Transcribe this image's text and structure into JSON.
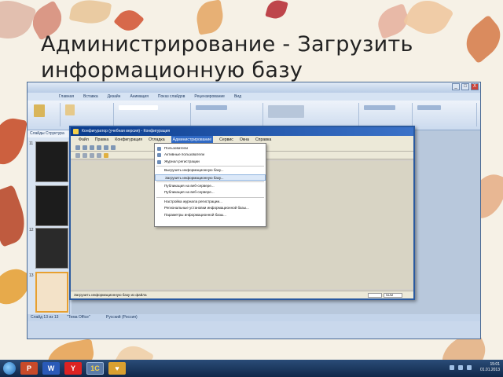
{
  "slide": {
    "title": "Администрирование - Загрузить информационную базу"
  },
  "powerpoint": {
    "window_buttons": [
      "_",
      "□",
      "X"
    ],
    "tabs": [
      "Главная",
      "Вставка",
      "Дизайн",
      "Анимация",
      "Показ слайдов",
      "Рецензирование",
      "Вид"
    ],
    "sidebar_tabs": "Слайды  Структура",
    "thumb_numbers": [
      "11",
      "12",
      "13"
    ],
    "status_slide": "Слайд 13 из 13",
    "status_theme": "\"Тема Office\"",
    "status_lang": "Русский (Россия)"
  },
  "taskbar": {
    "apps": [
      "P",
      "W",
      "Y",
      "1C",
      "♥"
    ],
    "time": "15:01",
    "date": "01.01.2013"
  },
  "onec": {
    "title": "Конфигуратор (учебная версия) - Конфигурация",
    "menu": [
      "Файл",
      "Правка",
      "Конфигурация",
      "Отладка",
      "Администрирование",
      "Сервис",
      "Окна",
      "Справка"
    ],
    "active_menu_index": 4,
    "dropdown": [
      "Пользователи",
      "Активные пользователи",
      "Журнал регистрации",
      "-",
      "Выгрузить информационную базу...",
      "Загрузить информационную базу...",
      "-",
      "Публикация на веб-сервере...",
      "Публикация на веб-сервере...",
      "-",
      "Настройка журнала регистрации...",
      "Региональные установки информационной базы...",
      "Параметры информационной базы..."
    ],
    "highlighted_index": 5,
    "status_text": "Загрузить информационную базу из файла",
    "status_cap": "CAP",
    "status_num": "NUM"
  }
}
